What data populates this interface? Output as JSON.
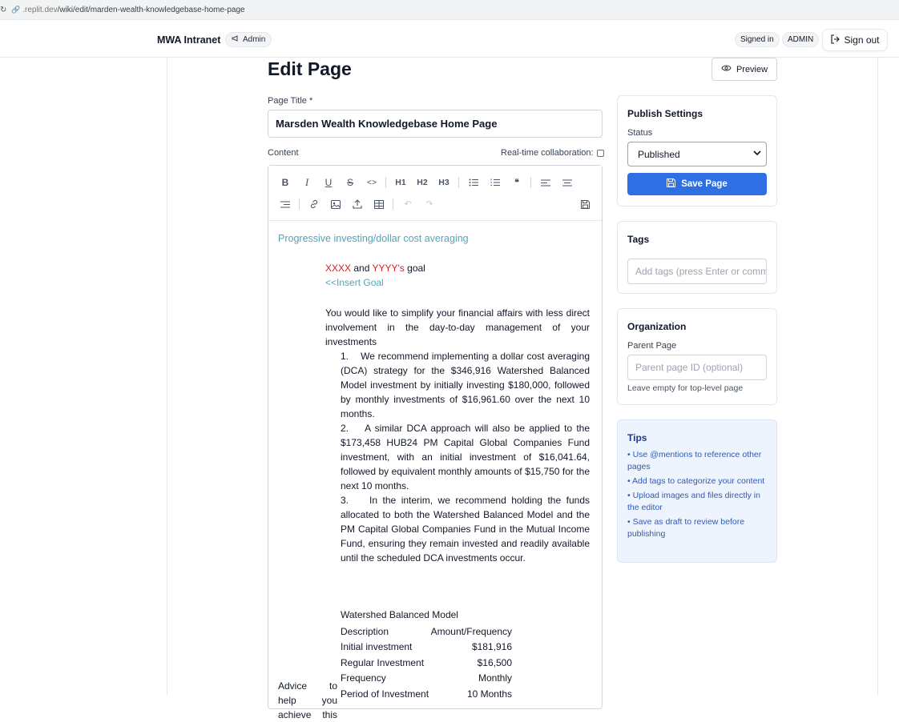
{
  "browser": {
    "url_host": ".replit.dev",
    "url_path": "/wiki/edit/marden-wealth-knowledgebase-home-page"
  },
  "header": {
    "brand": "MWA Intranet",
    "admin_chip": "Admin",
    "signed_in": "Signed in",
    "role": "ADMIN",
    "sign_out": "Sign out"
  },
  "page": {
    "title": "Edit Page",
    "preview": "Preview",
    "title_label": "Page Title *",
    "title_value": "Marsden Wealth Knowledgebase Home Page",
    "content_label": "Content",
    "rtc_label": "Real-time collaboration:"
  },
  "toolbar": {
    "row1": [
      "bold-icon",
      "italic-icon",
      "underline-icon",
      "strikethrough-icon",
      "code-icon",
      "h1-icon",
      "h2-icon",
      "h3-icon",
      "bullet-list-icon",
      "ordered-list-icon",
      "quote-icon",
      "align-left-icon",
      "align-center-icon"
    ],
    "row2": [
      "align-right-icon",
      "link-icon",
      "image-icon",
      "upload-icon",
      "table-icon",
      "undo-icon",
      "redo-icon",
      "save-icon"
    ],
    "h1": "H1",
    "h2": "H2",
    "h3": "H3"
  },
  "content": {
    "heading": "Progressive investing/dollar cost averaging",
    "goal_xxxx": "XXXX",
    "goal_and": " and ",
    "goal_yyyy": "YYYY's",
    "goal_suffix": " goal",
    "insert_goal": "<<Insert Goal",
    "intro": "You would like to simplify your financial affairs with less direct involvement in the day-to-day management of your investments",
    "recs": [
      "1.    We recommend implementing a dollar cost averaging (DCA) strategy for the $346,916 Watershed Balanced Model investment by initially investing $180,000, followed by monthly investments of $16,961.60 over the next 10 months.",
      "2.    A similar DCA approach will also be applied to the $173,458 HUB24 PM Capital Global Companies Fund investment, with an initial investment of $16,041.64, followed by equivalent monthly amounts of $15,750 for the next 10 months.",
      "3.    In the interim, we recommend holding the funds allocated to both the Watershed Balanced Model and the PM Capital Global Companies Fund in the Mutual Income Fund, ensuring they remain invested and readily available until the scheduled DCA investments occur."
    ],
    "side_label": "Advice to help you achieve this",
    "table_title": "Watershed Balanced Model",
    "table_header": [
      "Description",
      "Amount/Frequency"
    ],
    "table_rows": [
      [
        "Initial investment",
        "$181,916"
      ],
      [
        "Regular Investment",
        "$16,500"
      ],
      [
        "Frequency",
        "Monthly"
      ],
      [
        "Period of Investment",
        "10 Months"
      ]
    ]
  },
  "sidebar": {
    "publish_title": "Publish Settings",
    "status_label": "Status",
    "status_value": "Published",
    "save": "Save Page",
    "tags_title": "Tags",
    "tags_placeholder": "Add tags (press Enter or comma)",
    "org_title": "Organization",
    "parent_label": "Parent Page",
    "parent_placeholder": "Parent page ID (optional)",
    "parent_help": "Leave empty for top-level page",
    "tips_title": "Tips",
    "tips": [
      "• Use @mentions to reference other pages",
      "• Add tags to categorize your content",
      "• Upload images and files directly in the editor",
      "• Save as draft to review before publishing"
    ]
  },
  "colors": {
    "accent": "#2f6fe4",
    "link_teal": "#55a3b8",
    "red": "#d42020",
    "tips_bg": "#eef4fd"
  }
}
